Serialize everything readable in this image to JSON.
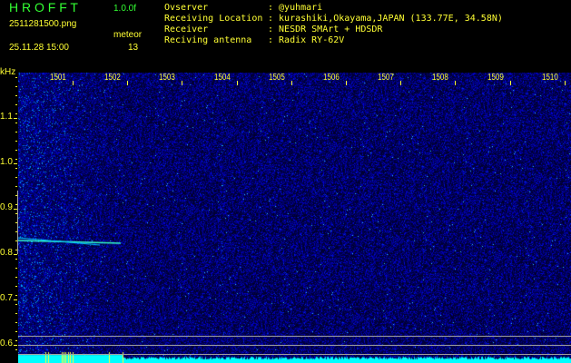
{
  "app": {
    "title": "H R O F F T",
    "version": "1.0.0f",
    "filename": "2511281500.png",
    "datetime": "25.11.28 15:00",
    "meteor_label": "meteor",
    "meteor_count": "13"
  },
  "info": [
    {
      "label": "Ovserver",
      "value": ": @yuhmari"
    },
    {
      "label": "Receiving Location",
      "value": ": kurashiki,Okayama,JAPAN (133.77E, 34.58N)"
    },
    {
      "label": "Receiver",
      "value": ": NESDR SMArt + HDSDR"
    },
    {
      "label": "Reciving antenna",
      "value": ": Radix RY-62V"
    }
  ],
  "axis": {
    "y_unit": "kHz",
    "x_labels": [
      "1501",
      "1502",
      "1503",
      "1504",
      "1505",
      "1506",
      "1507",
      "1508",
      "1509",
      "1510"
    ],
    "y_labels": [
      "1.1",
      "1.0",
      "0.9",
      "0.8",
      "0.7",
      "0.6"
    ]
  },
  "colors": {
    "text": "#ffff33",
    "title": "#33ff33",
    "background": "#000080",
    "signal": "#00ffff"
  }
}
